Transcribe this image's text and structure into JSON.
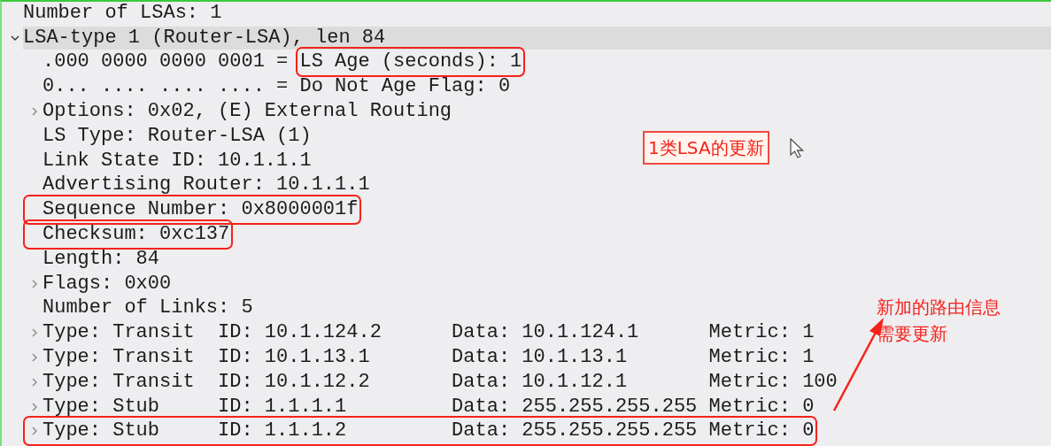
{
  "tree": [
    {
      "text": "Number of LSAs: 1",
      "selected": false,
      "boxed": false
    },
    {
      "text": "LSA-type 1 (Router-LSA), len 84",
      "expanded": true,
      "selected": true,
      "boxed": false,
      "children": [
        {
          "prefix": ".000 0000 0000 0001 = ",
          "text": "LS Age (seconds): 1",
          "selected": false,
          "boxed": true
        },
        {
          "prefix": "0... .... .... .... = ",
          "text": "Do Not Age Flag: 0",
          "selected": false,
          "boxed": false
        },
        {
          "text": "Options: 0x02, (E) External Routing",
          "expanded": false,
          "selected": false,
          "boxed": false
        },
        {
          "text": "LS Type: Router-LSA (1)",
          "selected": false,
          "boxed": false
        },
        {
          "text": "Link State ID: 10.1.1.1",
          "selected": false,
          "boxed": false
        },
        {
          "text": "Advertising Router: 10.1.1.1",
          "selected": false,
          "boxed": false
        },
        {
          "text": "Sequence Number: 0x8000001f",
          "selected": false,
          "boxed": true
        },
        {
          "text": "Checksum: 0xc137",
          "selected": false,
          "boxed": true
        },
        {
          "text": "Length: 84",
          "selected": false,
          "boxed": false
        },
        {
          "text": "Flags: 0x00",
          "expanded": false,
          "selected": false,
          "boxed": false
        },
        {
          "text": "Number of Links: 5",
          "selected": false,
          "boxed": false
        },
        {
          "text": "Type: Transit  ID: 10.1.124.2      Data: 10.1.124.1      Metric: 1",
          "expanded": false,
          "selected": false,
          "boxed": false
        },
        {
          "text": "Type: Transit  ID: 10.1.13.1       Data: 10.1.13.1       Metric: 1",
          "expanded": false,
          "selected": false,
          "boxed": false
        },
        {
          "text": "Type: Transit  ID: 10.1.12.2       Data: 10.1.12.1       Metric: 100",
          "expanded": false,
          "selected": false,
          "boxed": false
        },
        {
          "text": "Type: Stub     ID: 1.1.1.1         Data: 255.255.255.255 Metric: 0",
          "expanded": false,
          "selected": false,
          "boxed": false
        },
        {
          "text": "Type: Stub     ID: 1.1.1.2         Data: 255.255.255.255 Metric: 0",
          "expanded": false,
          "selected": false,
          "boxed": true
        }
      ]
    }
  ],
  "annotations": [
    {
      "kind": "boxed-note",
      "lines": [
        "1类LSA的更新"
      ]
    },
    {
      "kind": "arrow-note",
      "lines": [
        "新加的路由信息",
        "需要更新"
      ]
    }
  ]
}
